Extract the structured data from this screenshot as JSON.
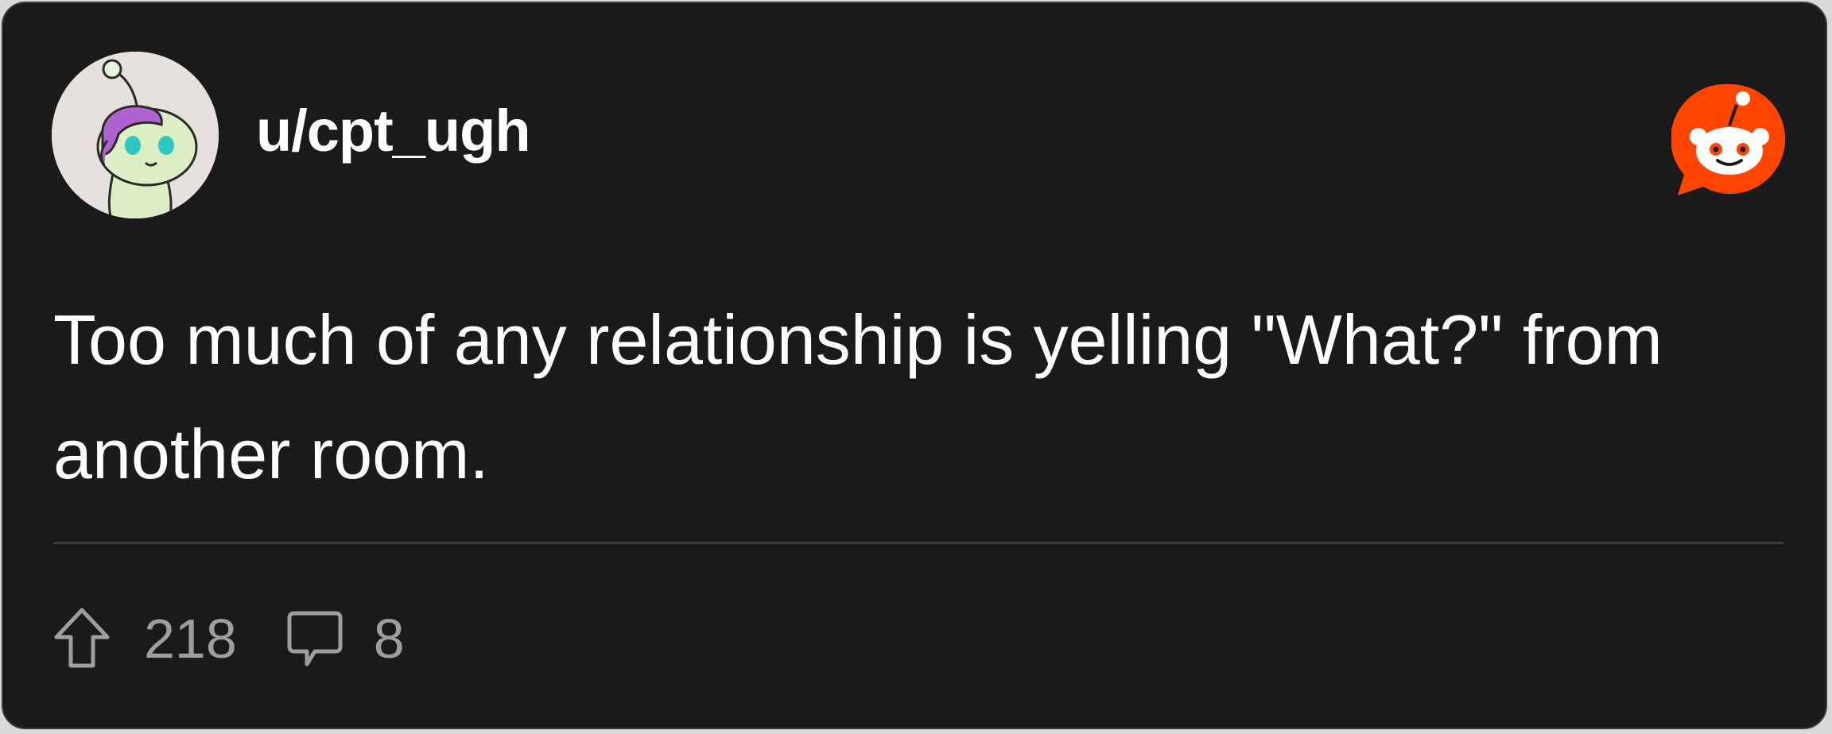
{
  "post": {
    "username": "u/cpt_ugh",
    "text": "Too much of any relationship is yelling \"What?\" from another room.",
    "upvotes": "218",
    "comments": "8"
  },
  "icons": {
    "avatar": "snoo-avatar",
    "brand": "reddit-logo-icon",
    "upvote": "upvote-arrow-icon",
    "comment": "comment-bubble-icon"
  },
  "colors": {
    "card_background": "#1a1a1a",
    "text_primary": "#ffffff",
    "text_secondary": "#9e9e9e",
    "brand_orange": "#ff4500",
    "divider": "#3a3a3a"
  }
}
